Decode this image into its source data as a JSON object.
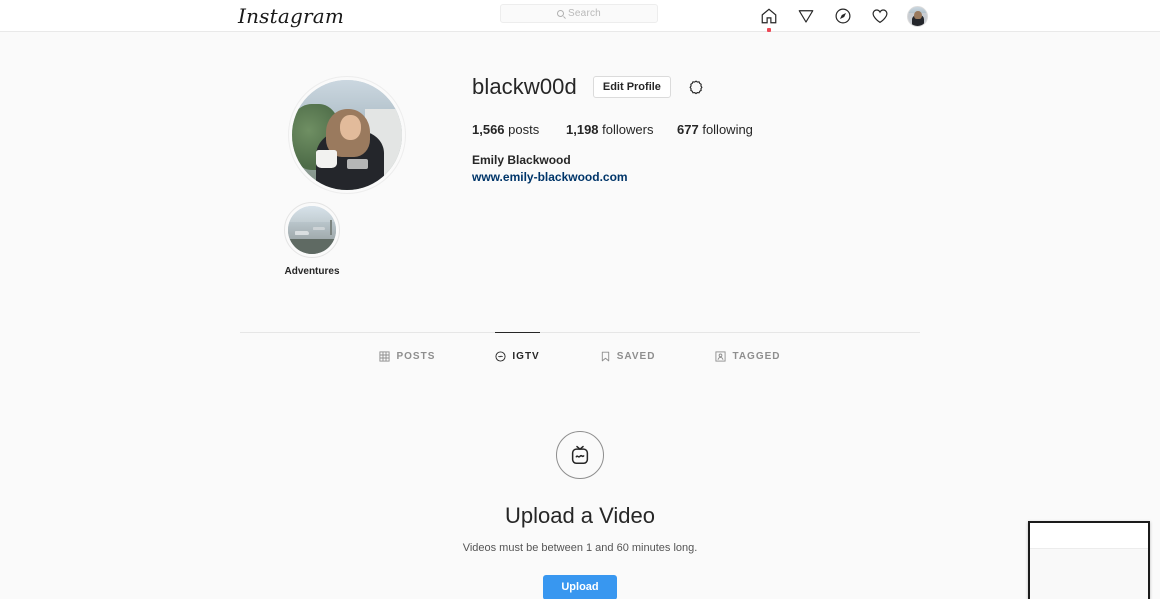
{
  "navbar": {
    "logo": "Instagram",
    "search": {
      "placeholder": "Search",
      "value": "",
      "icon": "search-icon"
    },
    "icons": [
      {
        "name": "home-icon",
        "label": "Home",
        "has_notification_dot": true
      },
      {
        "name": "direct-messages-icon",
        "label": "Direct"
      },
      {
        "name": "explore-compass-icon",
        "label": "Explore"
      },
      {
        "name": "activity-heart-icon",
        "label": "Activity"
      },
      {
        "name": "profile-avatar",
        "label": "Profile"
      }
    ],
    "notification_dot_color": "#ed4956"
  },
  "profile": {
    "username": "blackw00d",
    "edit_profile_label": "Edit Profile",
    "settings_icon": "gear-icon",
    "stats": [
      {
        "count": "1,566",
        "label": "posts"
      },
      {
        "count": "1,198",
        "label": "followers"
      },
      {
        "count": "677",
        "label": "following"
      }
    ],
    "full_name": "Emily Blackwood",
    "website": "www.emily-blackwood.com",
    "website_color": "#003569",
    "avatar_alt": "Woman with long hair in dark sweatshirt holding a white mug on a balcony"
  },
  "highlights": [
    {
      "label": "Adventures",
      "alt": "Harbor with boats at dusk"
    }
  ],
  "tabs": [
    {
      "id": "posts",
      "label": "POSTS",
      "icon": "grid-icon",
      "active": false
    },
    {
      "id": "igtv",
      "label": "IGTV",
      "icon": "igtv-icon",
      "active": true
    },
    {
      "id": "saved",
      "label": "SAVED",
      "icon": "bookmark-icon",
      "active": false
    },
    {
      "id": "tagged",
      "label": "TAGGED",
      "icon": "tagged-person-icon",
      "active": false
    }
  ],
  "igtv_empty": {
    "icon": "igtv-tv-icon",
    "title": "Upload a Video",
    "subtitle": "Videos must be between 1 and 60 minutes long.",
    "upload_label": "Upload",
    "upload_color": "#3897f0"
  },
  "overlay_window": {
    "name": "floating-window",
    "border_color": "#1b1b1b"
  }
}
